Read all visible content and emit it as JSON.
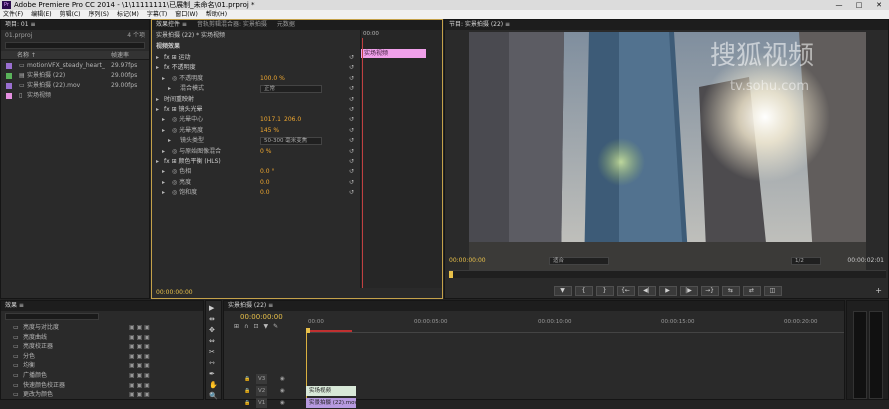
{
  "app": {
    "title": "Adobe Premiere Pro CC 2014 - \\1\\11111111\\已展制_未命名\\01.prproj *",
    "logo": "Pr",
    "window_controls": [
      "—",
      "□",
      "✕"
    ]
  },
  "menu": [
    "文件(F)",
    "编辑(E)",
    "剪辑(C)",
    "序列(S)",
    "标记(M)",
    "字幕(T)",
    "窗口(W)",
    "帮助(H)"
  ],
  "project": {
    "tab": "项目: 01 ≡",
    "file": "01.prproj",
    "count": "4 个项",
    "col_name": "名称 ↑",
    "col_rate": "帧速率",
    "items": [
      {
        "name": "motionVFX_steady_heart_",
        "rate": "29.97fps",
        "color": "#9a6fd0"
      },
      {
        "name": "实景拍摄 (22)",
        "rate": "29.00fps",
        "color": "#5ab35a"
      },
      {
        "name": "实景拍摄 (22).mov",
        "rate": "29.00fps",
        "color": "#9a6fd0"
      },
      {
        "name": "实场视频",
        "rate": "",
        "color": "#e58fe0"
      }
    ]
  },
  "effect_controls": {
    "tabs": [
      "效果控件 ≡",
      "音轨剪辑混合器: 实景拍摄",
      "元数据"
    ],
    "clip": "实景拍摄 (22) * 实场视频",
    "ruler_time": "00:00",
    "clip_bar": "实场视频",
    "section_video": "视频效果",
    "rows": [
      {
        "label": "fx ⊞ 运动",
        "indent": 1
      },
      {
        "label": "fx 不透明度",
        "indent": 1
      },
      {
        "label": "◎ 不透明度",
        "value": "100.0 %",
        "indent": 2
      },
      {
        "label": "混合模式",
        "value": "正常",
        "indent": 3,
        "dropdown": true
      },
      {
        "label": "时间重映射",
        "indent": 1
      },
      {
        "label": "fx ⊞ 镜头光晕",
        "indent": 1
      },
      {
        "label": "◎ 光晕中心",
        "value": "1017.1",
        "value2": "206.0",
        "indent": 2
      },
      {
        "label": "◎ 光晕亮度",
        "value": "145 %",
        "indent": 2
      },
      {
        "label": "镜头类型",
        "value": "50-300 毫米变焦",
        "indent": 3,
        "dropdown": true
      },
      {
        "label": "◎ 与原始图像混合",
        "value": "0 %",
        "indent": 2
      },
      {
        "label": "fx ⊞ 颜色平衡 (HLS)",
        "indent": 1
      },
      {
        "label": "◎ 色相",
        "value": "0.0 °",
        "indent": 2
      },
      {
        "label": "◎ 亮度",
        "value": "0.0",
        "indent": 2
      },
      {
        "label": "◎ 饱和度",
        "value": "0.0",
        "indent": 2
      }
    ],
    "timecode": "00:00:00:00"
  },
  "program": {
    "tab": "节目: 实景拍摄 (22) ≡",
    "watermark": "搜狐视频",
    "watermark_url": "tv.sohu.com",
    "timecode": "00:00:00:00",
    "fit": "适合",
    "quality": "1/2",
    "duration": "00:00:02:01",
    "controls": [
      "▼",
      "{",
      "}",
      "{←",
      "◀|",
      "▶",
      "|▶",
      "→}",
      "⇆",
      "⇄",
      "◫"
    ],
    "add": "+"
  },
  "effects": {
    "tab": "效果 ≡",
    "items": [
      "亮度与对比度",
      "亮度曲线",
      "亮度校正器",
      "分色",
      "均衡",
      "广播颜色",
      "快速颜色校正器",
      "更改为颜色"
    ]
  },
  "timeline": {
    "tab": "实景拍摄 (22) ≡",
    "timecode": "00:00:00:00",
    "ruler": [
      "00:00",
      "00:00:05:00",
      "00:00:10:00",
      "00:00:15:00",
      "00:00:20:00"
    ],
    "tracks": [
      {
        "name": "V3",
        "clip": ""
      },
      {
        "name": "V2",
        "clip": "实场视频"
      },
      {
        "name": "V1",
        "clip": "实景拍摄 (22).mov [V]"
      }
    ]
  },
  "tools": [
    "▶",
    "⇹",
    "✥",
    "⇔",
    "✂",
    "⇿",
    "✒",
    "✋",
    "🔍"
  ],
  "colors": {
    "accent_blue": "#4ea3ff",
    "accent_orange": "#f0a830",
    "clip_pink": "#f0a0ea",
    "clip_green": "#d8e8d8"
  }
}
